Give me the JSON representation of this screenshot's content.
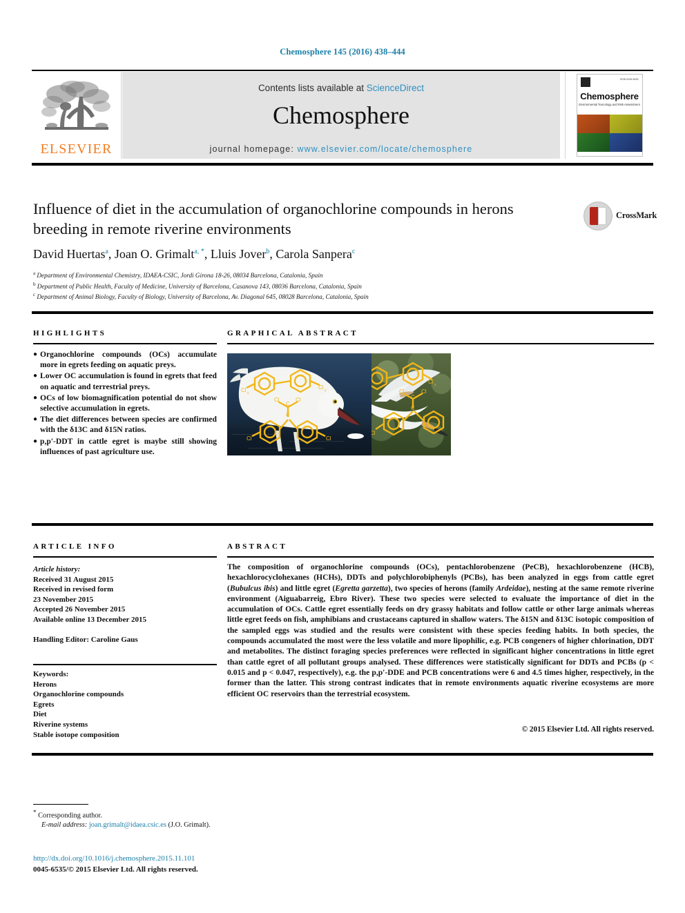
{
  "running_head": "Chemosphere 145 (2016) 438–444",
  "masthead": {
    "publisher_logo_label": "ELSEVIER",
    "contents_prefix": "Contents lists available at ",
    "contents_link": "ScienceDirect",
    "journal_name": "Chemosphere",
    "homepage_prefix": "journal homepage: ",
    "homepage_url": "www.elsevier.com/locate/chemosphere",
    "cover": {
      "title": "Chemosphere",
      "subtitle": "Environmental Toxicology and Risk Assessment",
      "corner_code": "ISSN 0045-6535"
    }
  },
  "article": {
    "title": "Influence of diet in the accumulation of organochlorine compounds in herons breeding in remote riverine environments",
    "crossmark_label": "CrossMark",
    "authors": [
      {
        "name": "David Huertas",
        "marks": "a"
      },
      {
        "name": "Joan O. Grimalt",
        "marks": "a, *"
      },
      {
        "name": "Lluis Jover",
        "marks": "b"
      },
      {
        "name": "Carola Sanpera",
        "marks": "c"
      }
    ],
    "affiliations": [
      {
        "mark": "a",
        "text": "Department of Environmental Chemistry, IDAEA-CSIC, Jordi Girona 18-26, 08034 Barcelona, Catalonia, Spain"
      },
      {
        "mark": "b",
        "text": "Department of Public Health, Faculty of Medicine, University of Barcelona, Casanova 143, 08036 Barcelona, Catalonia, Spain"
      },
      {
        "mark": "c",
        "text": "Department of Animal Biology, Faculty of Biology, University of Barcelona, Av. Diagonal 645, 08028 Barcelona, Catalonia, Spain"
      }
    ]
  },
  "highlights": {
    "heading": "HIGHLIGHTS",
    "items": [
      "Organochlorine compounds (OCs) accumulate more in egrets feeding on aquatic preys.",
      "Lower OC accumulation is found in egrets that feed on aquatic and terrestrial preys.",
      "OCs of low biomagnification potential do not show selective accumulation in egrets.",
      "The diet differences between species are confirmed with the δ13C and δ15N ratios.",
      "p,p'-DDT in cattle egret is maybe still showing influences of past agriculture use."
    ]
  },
  "graphical_abstract": {
    "heading": "GRAPHICAL ABSTRACT",
    "image_caption": "Two photographs of white egrets wading and flying over water, overlaid with yellow organochlorine (PCB / DDT) molecular structure diagrams.",
    "molecule_labels": [
      "Cl",
      "Cl",
      "Cl",
      "Cl",
      "Cl",
      "C",
      "Cl",
      "Cl"
    ],
    "overlay_color": "#f2b617"
  },
  "article_info": {
    "heading": "ARTICLE INFO",
    "history_label": "Article history:",
    "history": [
      "Received 31 August 2015",
      "Received in revised form",
      "23 November 2015",
      "Accepted 26 November 2015",
      "Available online 13 December 2015"
    ],
    "handling_editor": "Handling Editor: Caroline Gaus",
    "keywords_label": "Keywords:",
    "keywords": [
      "Herons",
      "Organochlorine compounds",
      "Egrets",
      "Diet",
      "Riverine systems",
      "Stable isotope composition"
    ]
  },
  "abstract": {
    "heading": "ABSTRACT",
    "paragraph_1": "The composition of organochlorine compounds (OCs), pentachlorobenzene (PeCB), hexachlorobenzene (HCB), hexachlorocyclohexanes (HCHs), DDTs and polychlorobiphenyls (PCBs), has been analyzed in eggs from cattle egret (",
    "species_1": "Bubulcus ibis",
    "paragraph_2": ") and little egret (",
    "species_2": "Egretta garzetta",
    "paragraph_3": "), two species of herons (family ",
    "family": "Ardeidae",
    "paragraph_4": "), nesting at the same remote riverine environment (Aiguabarreig, Ebro River). These two species were selected to evaluate the importance of diet in the accumulation of OCs. Cattle egret essentially feeds on dry grassy habitats and follow cattle or other large animals whereas little egret feeds on fish, amphibians and crustaceans captured in shallow waters. The δ15N and δ13C isotopic composition of the sampled eggs was studied and the results were consistent with these species feeding habits. In both species, the compounds accumulated the most were the less volatile and more lipophilic, e.g. PCB congeners of higher chlorination, DDT and metabolites. The distinct foraging species preferences were reflected in significant higher concentrations in little egret than cattle egret of all pollutant groups analysed. These differences were statistically significant for DDTs and PCBs (p < 0.015 and p < 0.047, respectively), e.g. the p,p'-DDE and PCB concentrations were 6 and 4.5 times higher, respectively, in the former than the latter. This strong contrast indicates that in remote environments aquatic riverine ecosystems are more efficient OC reservoirs than the terrestrial ecosystem.",
    "copyright": "© 2015 Elsevier Ltd. All rights reserved."
  },
  "footer": {
    "corresponding_author": "Corresponding author.",
    "email_label": "E-mail address:",
    "email": "joan.grimalt@idaea.csic.es",
    "email_owner": "(J.O. Grimalt).",
    "doi": "http://dx.doi.org/10.1016/j.chemosphere.2015.11.101",
    "issn_line": "0045-6535/© 2015 Elsevier Ltd. All rights reserved."
  }
}
